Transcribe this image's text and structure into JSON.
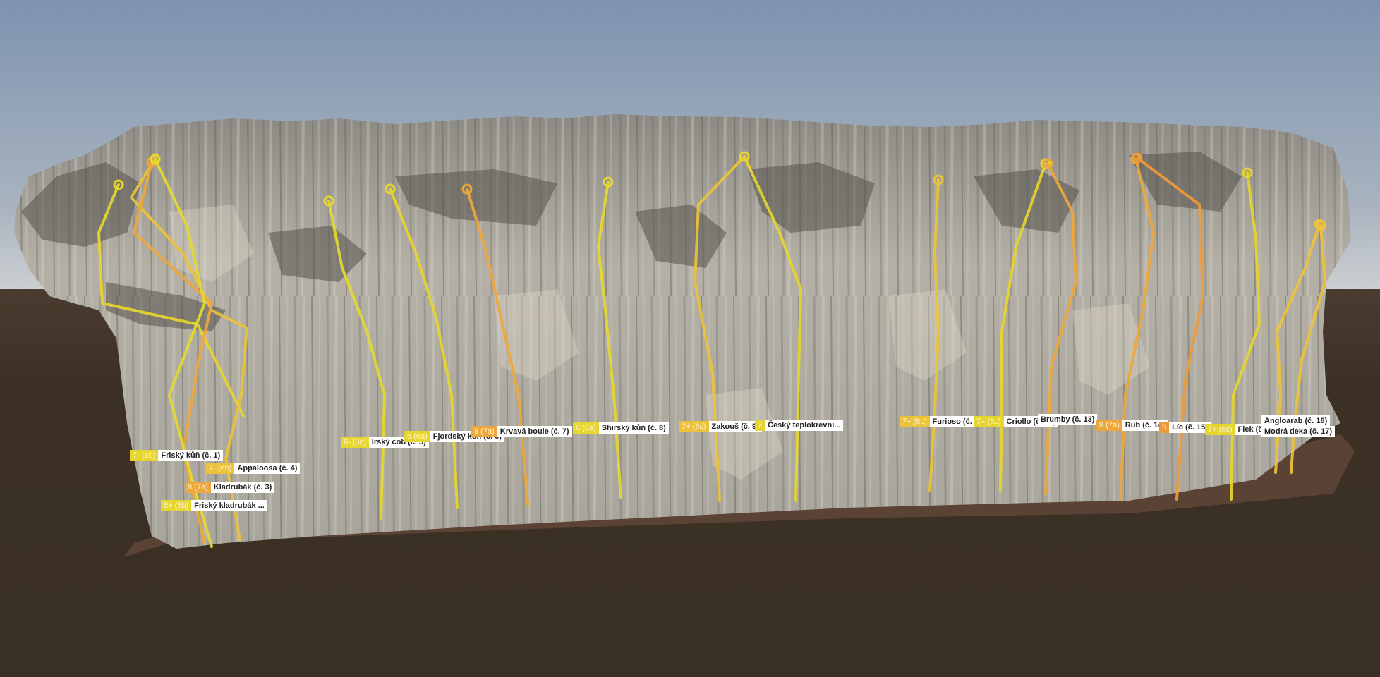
{
  "colors": {
    "sky_top": "#7f94b0",
    "sky_bottom": "#c7ccd1",
    "ground": "#3b2f24",
    "route_yellow": "#e6d830",
    "route_gold": "#eec23a",
    "route_orange": "#eea73c"
  },
  "routes": [
    {
      "id": "r1",
      "grade": "7- (6b)",
      "name": "Friský kůň (č. 1)",
      "color": "#e6d52f"
    },
    {
      "id": "r4",
      "grade": "7- (6b)",
      "name": "Appaloosa (č. 4)",
      "color": "#ecc23a"
    },
    {
      "id": "r3",
      "grade": "8 (7a)",
      "name": "Kladrubák (č. 3)",
      "color": "#eea73c"
    },
    {
      "id": "r2",
      "grade": "5+ (5b)",
      "name": "Friský kladrubák ...",
      "color": "#e6d830"
    },
    {
      "id": "r5",
      "grade": "6- (5c)",
      "name": "Irský cob (č. 5)",
      "color": "#e6d830"
    },
    {
      "id": "r6",
      "grade": "6 (6a)",
      "name": "Fjordský kůň (č. 6)",
      "color": "#e6d52f"
    },
    {
      "id": "r7",
      "grade": "8 (7a)",
      "name": "Krvavá boule (č. 7)",
      "color": "#eea73c"
    },
    {
      "id": "r8",
      "grade": "6 (6a)",
      "name": "Shirský kůň (č. 8)",
      "color": "#e6d830"
    },
    {
      "id": "r9",
      "grade": "7+ (6c)",
      "name": "Zakouš (č. 9)",
      "color": "#ecc23a"
    },
    {
      "id": "r10",
      "grade": "7",
      "name": "Český teplokrevní...",
      "color": "#e6d52f"
    },
    {
      "id": "r11",
      "grade": "7+ (6c)",
      "name": "Furioso (č. 11)",
      "color": "#ecc23a"
    },
    {
      "id": "r12",
      "grade": "7+ (6c)",
      "name": "Criollo (č. 12)",
      "color": "#e6d52f"
    },
    {
      "id": "r13",
      "grade": "",
      "name": "Brumby (č. 13)",
      "color": "#eea73c"
    },
    {
      "id": "r14",
      "grade": "8 (7a)",
      "name": "Rub (č. 14)",
      "color": "#eea73c"
    },
    {
      "id": "r15",
      "grade": "9",
      "name": "Líc (č. 15)",
      "color": "#ef9a38"
    },
    {
      "id": "r16",
      "grade": "7+ (6c)",
      "name": "Flek (č. 16)",
      "color": "#e6d52f"
    },
    {
      "id": "r18",
      "grade": "",
      "name": "Angloarab (č. 18)",
      "color": "#eec23a"
    },
    {
      "id": "r17",
      "grade": "",
      "name": "Modrá deka (č. 17)",
      "color": "#eec23a"
    }
  ]
}
